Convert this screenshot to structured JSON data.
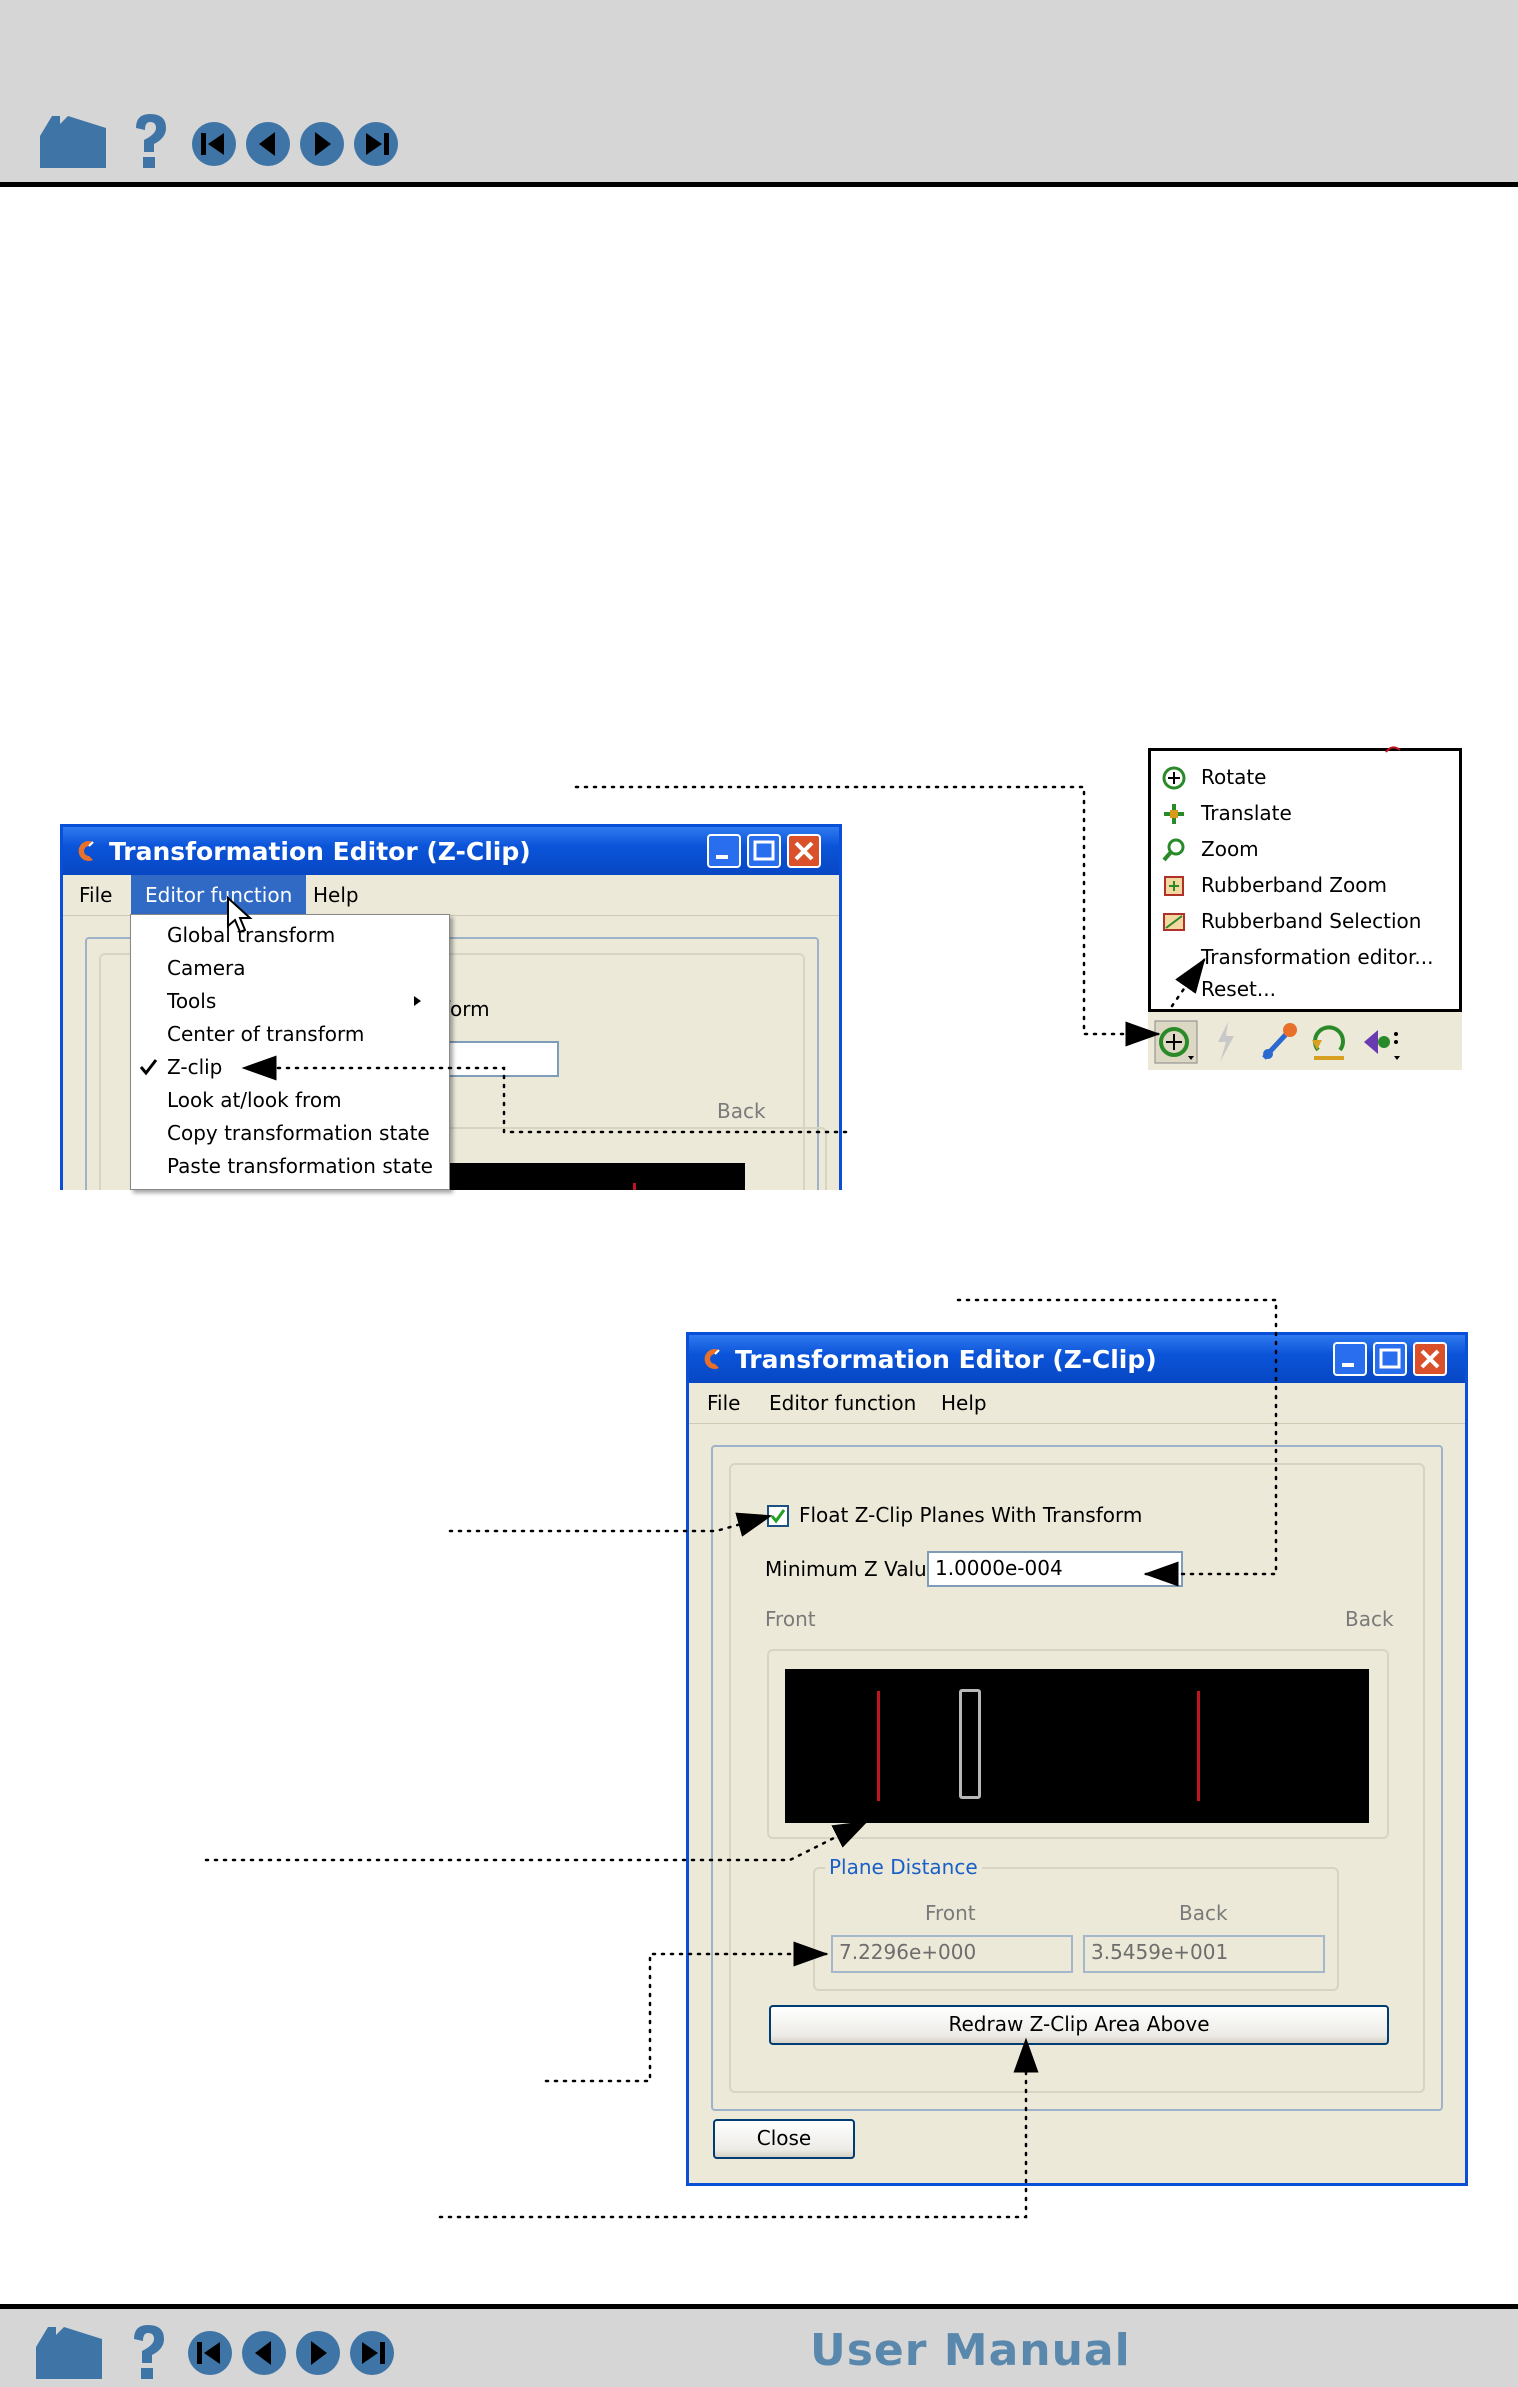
{
  "nav": {
    "icons": [
      "home-icon",
      "help-icon",
      "first-page-icon",
      "previous-page-icon",
      "next-page-icon",
      "last-page-icon"
    ],
    "footer_title": "User Manual"
  },
  "window1": {
    "title": "Transformation Editor (Z-Clip)",
    "menus": [
      "File",
      "Editor function",
      "Help"
    ],
    "partial_label": "form",
    "partial_back": "Back",
    "dropdown": {
      "items": [
        "Global transform",
        "Camera",
        "Tools",
        "Center of transform",
        "Z-clip",
        "Look at/look from",
        "Copy transformation state",
        "Paste transformation state"
      ],
      "checked": "Z-clip",
      "submenu": "Tools"
    }
  },
  "popup_menu": {
    "items": [
      "Rotate",
      "Translate",
      "Zoom",
      "Rubberband Zoom",
      "Rubberband Selection",
      "Transformation editor...",
      "Reset..."
    ],
    "icons": [
      "rotate-icon",
      "translate-icon",
      "zoom-icon",
      "rubberband-zoom-icon",
      "rubberband-selection-icon"
    ]
  },
  "window2": {
    "title": "Transformation Editor (Z-Clip)",
    "menus": [
      "File",
      "Editor function",
      "Help"
    ],
    "float_checkbox_label": "Float Z-Clip Planes With Transform",
    "float_checked": true,
    "min_z_label": "Minimum Z Value",
    "min_z_value": "1.0000e-004",
    "front_label": "Front",
    "back_label": "Back",
    "plane_distance": {
      "title": "Plane Distance",
      "front_label": "Front",
      "back_label": "Back",
      "front_value": "7.2296e+000",
      "back_value": "3.5459e+001"
    },
    "redraw_button": "Redraw Z-Clip Area Above",
    "close_button": "Close"
  },
  "colors": {
    "bar": "#d6d6d6",
    "nav_icon": "#3f74a6",
    "titlebar": "#0b54d9",
    "clip_line": "#c0141e"
  }
}
